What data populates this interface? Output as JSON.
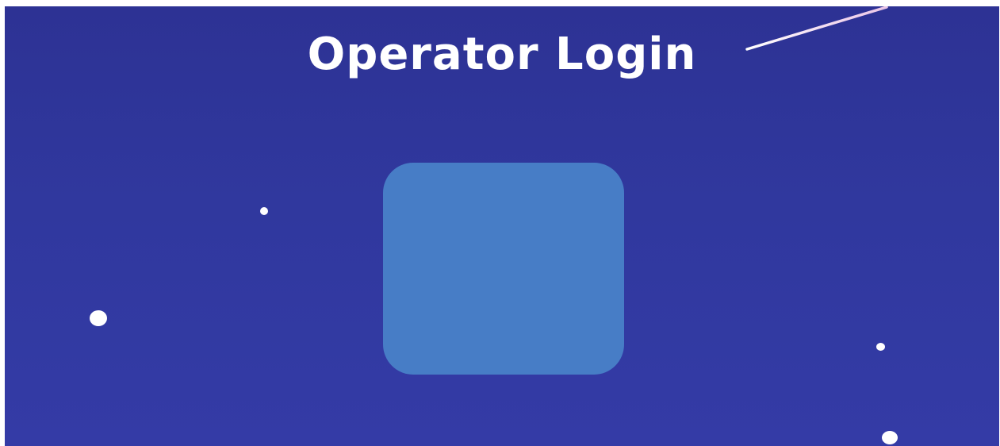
{
  "header": {
    "title": "Operator Login"
  },
  "colors": {
    "background_top": "#2d3294",
    "background_bottom": "#343ba6",
    "card": "#477dc6",
    "text": "#ffffff"
  },
  "decorations": {
    "stars": [
      "star-icon",
      "star-icon",
      "star-icon",
      "star-icon"
    ],
    "shooting_star": "shooting-star-icon"
  }
}
